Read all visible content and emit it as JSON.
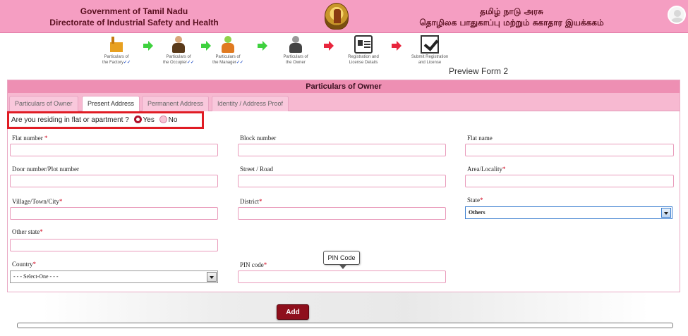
{
  "header": {
    "left_line1": "Government of Tamil Nadu",
    "left_line2": "Directorate of Industrial Safety and Health",
    "right_line1": "தமிழ் நாடு அரசு",
    "right_line2": "தொழிலக பாதுகாப்பு மற்றும் சுகாதார இயக்ககம்"
  },
  "steps": [
    {
      "label1": "Particulars of",
      "label2": "the Factory",
      "check": "✓✓",
      "icon": "factory-icon"
    },
    {
      "label1": "Particulars of",
      "label2": "the Occupier",
      "check": "✓✓",
      "icon": "occupier-icon"
    },
    {
      "label1": "Particulars of",
      "label2": "the Manager",
      "check": "✓✓",
      "icon": "manager-icon"
    },
    {
      "label1": "Particulars of",
      "label2": "the Owner",
      "check": "",
      "icon": "owner-icon"
    },
    {
      "label1": "Registration and",
      "label2": "License Details",
      "check": "",
      "icon": "id-card-icon"
    },
    {
      "label1": "Submit Registration",
      "label2": "and License",
      "check": "",
      "icon": "submit-check-icon"
    }
  ],
  "preview_label": "Preview Form 2",
  "panel": {
    "title": "Particulars of Owner",
    "tabs": [
      "Particulars of Owner",
      "Present Address",
      "Permanent Address",
      "Identity / Address Proof"
    ],
    "active_tab": "Present Address"
  },
  "question": {
    "text": "Are you residing in flat or apartment ?",
    "yes": "Yes",
    "no": "No",
    "selected": "Yes"
  },
  "fields": {
    "flat_number": "Flat number",
    "block_number": "Block number",
    "flat_name": "Flat name",
    "door_number": "Door number/Plot number",
    "street": "Street / Road",
    "area": "Area/Locality",
    "village": "Village/Town/City",
    "district": "District",
    "state": "State",
    "state_value": "Others",
    "other_state": "Other state",
    "country": "Country",
    "country_value": "- - - Select-One - - -",
    "pin_code": "PIN code",
    "required_mark": "*"
  },
  "tooltip": "PIN Code",
  "add_button": "Add",
  "colors": {
    "header_bg": "#f59ec2",
    "tab_bar": "#f7b9d1",
    "highlight_border": "#e01c24",
    "button": "#8e0f1c",
    "required": "#d0021b"
  }
}
